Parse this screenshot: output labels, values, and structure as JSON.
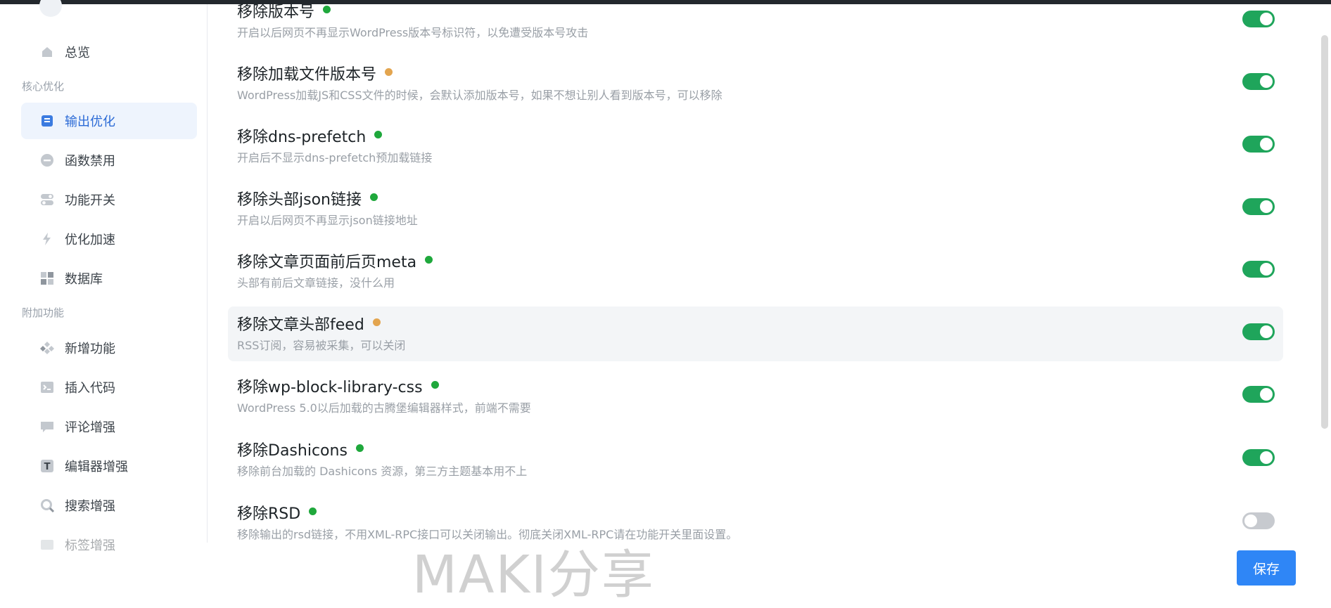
{
  "sidebar": {
    "groups": {
      "core": "核心优化",
      "extra": "附加功能"
    },
    "items": {
      "overview": "总览",
      "output": "输出优化",
      "disable_functions": "函数禁用",
      "feature_switch": "功能开关",
      "speedup": "优化加速",
      "database": "数据库",
      "new_features": "新增功能",
      "insert_code": "插入代码",
      "comments": "评论增强",
      "editor": "编辑器增强",
      "search": "搜索增强",
      "more": "标签增强"
    }
  },
  "settings": [
    {
      "title": "移除版本号",
      "desc": "开启以后网页不再显示WordPress版本号标识符，以免遭受版本号攻击",
      "dot": "green",
      "enabled": true
    },
    {
      "title": "移除加载文件版本号",
      "desc": "WordPress加载JS和CSS文件的时候，会默认添加版本号，如果不想让别人看到版本号，可以移除",
      "dot": "orange",
      "enabled": true
    },
    {
      "title": "移除dns-prefetch",
      "desc": "开启后不显示dns-prefetch预加载链接",
      "dot": "green",
      "enabled": true
    },
    {
      "title": "移除头部json链接",
      "desc": "开启以后网页不再显示json链接地址",
      "dot": "green",
      "enabled": true
    },
    {
      "title": "移除文章页面前后页meta",
      "desc": "头部有前后文章链接，没什么用",
      "dot": "green",
      "enabled": true
    },
    {
      "title": "移除文章头部feed",
      "desc": "RSS订阅，容易被采集，可以关闭",
      "dot": "orange",
      "enabled": true
    },
    {
      "title": "移除wp-block-library-css",
      "desc": "WordPress 5.0以后加载的古腾堡编辑器样式，前端不需要",
      "dot": "green",
      "enabled": true
    },
    {
      "title": "移除Dashicons",
      "desc": "移除前台加载的 Dashicons 资源，第三方主题基本用不上",
      "dot": "green",
      "enabled": true
    },
    {
      "title": "移除RSD",
      "desc": "移除输出的rsd链接，不用XML-RPC接口可以关闭输出。彻底关闭XML-RPC请在功能开关里面设置。",
      "dot": "green",
      "enabled": false
    }
  ],
  "footer": {
    "save_label": "保存"
  },
  "watermark": "MAKI分享",
  "colors": {
    "accent": "#2f86f6",
    "toggle_on": "#1fa55b",
    "dot_green": "#1fa83c",
    "dot_orange": "#e3a54f"
  }
}
